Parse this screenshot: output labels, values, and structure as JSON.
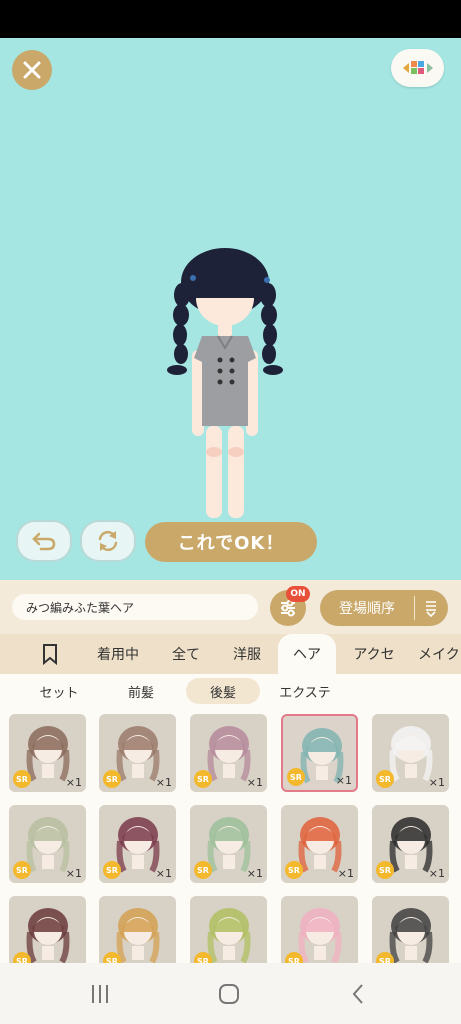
{
  "header": {
    "close_icon": "close-icon",
    "palette_icon": "palette-icon"
  },
  "controls": {
    "undo_icon": "undo-icon",
    "rotate_icon": "rotate-icon",
    "ok_label": "これでOK！"
  },
  "filter_bar": {
    "current_item_name": "みつ編みふた葉ヘア",
    "filter_icon": "sliders-icon",
    "filter_badge": "ON",
    "sort_label": "登場順序",
    "sort_icon": "sort-icon"
  },
  "tabs": [
    {
      "label": "",
      "icon": "bookmark-icon"
    },
    {
      "label": "着用中"
    },
    {
      "label": "全て"
    },
    {
      "label": "洋服"
    },
    {
      "label": "ヘア",
      "active": true
    },
    {
      "label": "アクセ"
    },
    {
      "label": "メイク"
    }
  ],
  "subtabs": [
    {
      "label": "セット"
    },
    {
      "label": "前髪"
    },
    {
      "label": "後髪",
      "active": true
    },
    {
      "label": "エクステ"
    }
  ],
  "items": [
    {
      "rarity": "SR",
      "count": "×1",
      "hair_color": "#8a6a5a"
    },
    {
      "rarity": "SR",
      "count": "×1",
      "hair_color": "#9a7a6a"
    },
    {
      "rarity": "SR",
      "count": "×1",
      "hair_color": "#b58a9a"
    },
    {
      "rarity": "SR",
      "count": "×1",
      "hair_color": "#7fb3b0",
      "selected": true
    },
    {
      "rarity": "SR",
      "count": "×1",
      "hair_color": "#f4f4f4"
    },
    {
      "rarity": "SR",
      "count": "×1",
      "hair_color": "#b8c0a0"
    },
    {
      "rarity": "SR",
      "count": "×1",
      "hair_color": "#7a3a4a"
    },
    {
      "rarity": "SR",
      "count": "×1",
      "hair_color": "#9cc09a"
    },
    {
      "rarity": "SR",
      "count": "×1",
      "hair_color": "#e0603a"
    },
    {
      "rarity": "SR",
      "count": "×1",
      "hair_color": "#2a2a2a"
    },
    {
      "rarity": "SR",
      "count": "",
      "hair_color": "#6a3a3a"
    },
    {
      "rarity": "SR",
      "count": "",
      "hair_color": "#d4a050"
    },
    {
      "rarity": "SR",
      "count": "",
      "hair_color": "#b0c060"
    },
    {
      "rarity": "SR",
      "count": "",
      "hair_color": "#f0b0c0"
    },
    {
      "rarity": "SR",
      "count": "",
      "hair_color": "#404040"
    }
  ],
  "navbar": {
    "recents_icon": "recents-icon",
    "home_icon": "home-icon",
    "back_icon": "back-icon"
  }
}
